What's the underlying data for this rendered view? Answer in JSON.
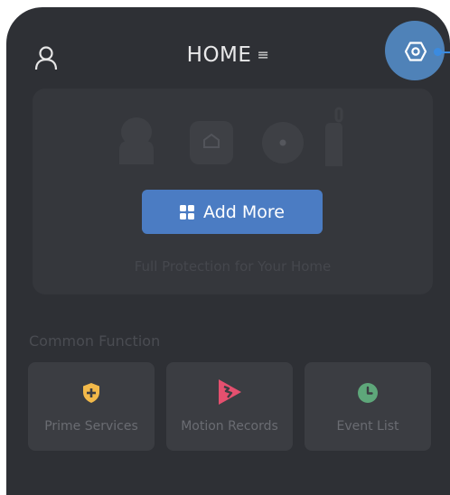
{
  "header": {
    "title": "HOME",
    "menu_glyph": "≡",
    "user_icon": "user-icon",
    "settings_icon": "hexagon-settings-icon"
  },
  "device_card": {
    "icons": [
      "camera-icon",
      "home-hub-icon",
      "disc-sensor-icon",
      "remote-key-icon"
    ],
    "add_button_label": "Add More",
    "caption": "Full Protection for Your Home"
  },
  "common_function": {
    "title": "Common Function",
    "items": [
      {
        "label": "Prime Services",
        "icon": "shield-plus-icon",
        "color": "#f2b94a"
      },
      {
        "label": "Motion Records",
        "icon": "motion-play-icon",
        "color": "#e5506f"
      },
      {
        "label": "Event List",
        "icon": "clock-icon",
        "color": "#5ea77a"
      }
    ]
  },
  "colors": {
    "background": "#2e3035",
    "accent": "#4b7cc3",
    "highlight": "#4f82b8"
  }
}
